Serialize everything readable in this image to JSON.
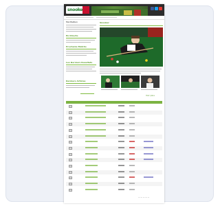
{
  "site": {
    "logo_text": "snooker",
    "left_labels": [
      "Ma Mailbox",
      "En Directe",
      "Prochains Matchs",
      "Les Derniers Resultats",
      "Derniers Articles",
      "Masters"
    ],
    "hero_title": "Snooker",
    "see_more": "Voir plus"
  },
  "table": {
    "rows": [
      {
        "name": "Welsh Open",
        "status": ""
      },
      {
        "name": "Welsh Open",
        "status": ""
      },
      {
        "name": "Welsh Open",
        "status": ""
      },
      {
        "name": "Welsh Open",
        "status": ""
      },
      {
        "name": "Welsh Open",
        "status": ""
      },
      {
        "name": "Welsh Open",
        "status": ""
      },
      {
        "name": "Masters",
        "status": "live"
      },
      {
        "name": "Masters",
        "status": "live"
      },
      {
        "name": "Masters",
        "status": "live"
      },
      {
        "name": "Masters",
        "status": "live"
      },
      {
        "name": "Masters",
        "status": ""
      },
      {
        "name": "Masters",
        "status": ""
      },
      {
        "name": "Masters",
        "status": "live"
      },
      {
        "name": "Masters",
        "status": ""
      },
      {
        "name": "Masters",
        "status": ""
      }
    ]
  },
  "colors": {
    "accent_green": "#7cb342",
    "header_dark": "#2c2c2c",
    "logo_red": "#c8102e"
  }
}
